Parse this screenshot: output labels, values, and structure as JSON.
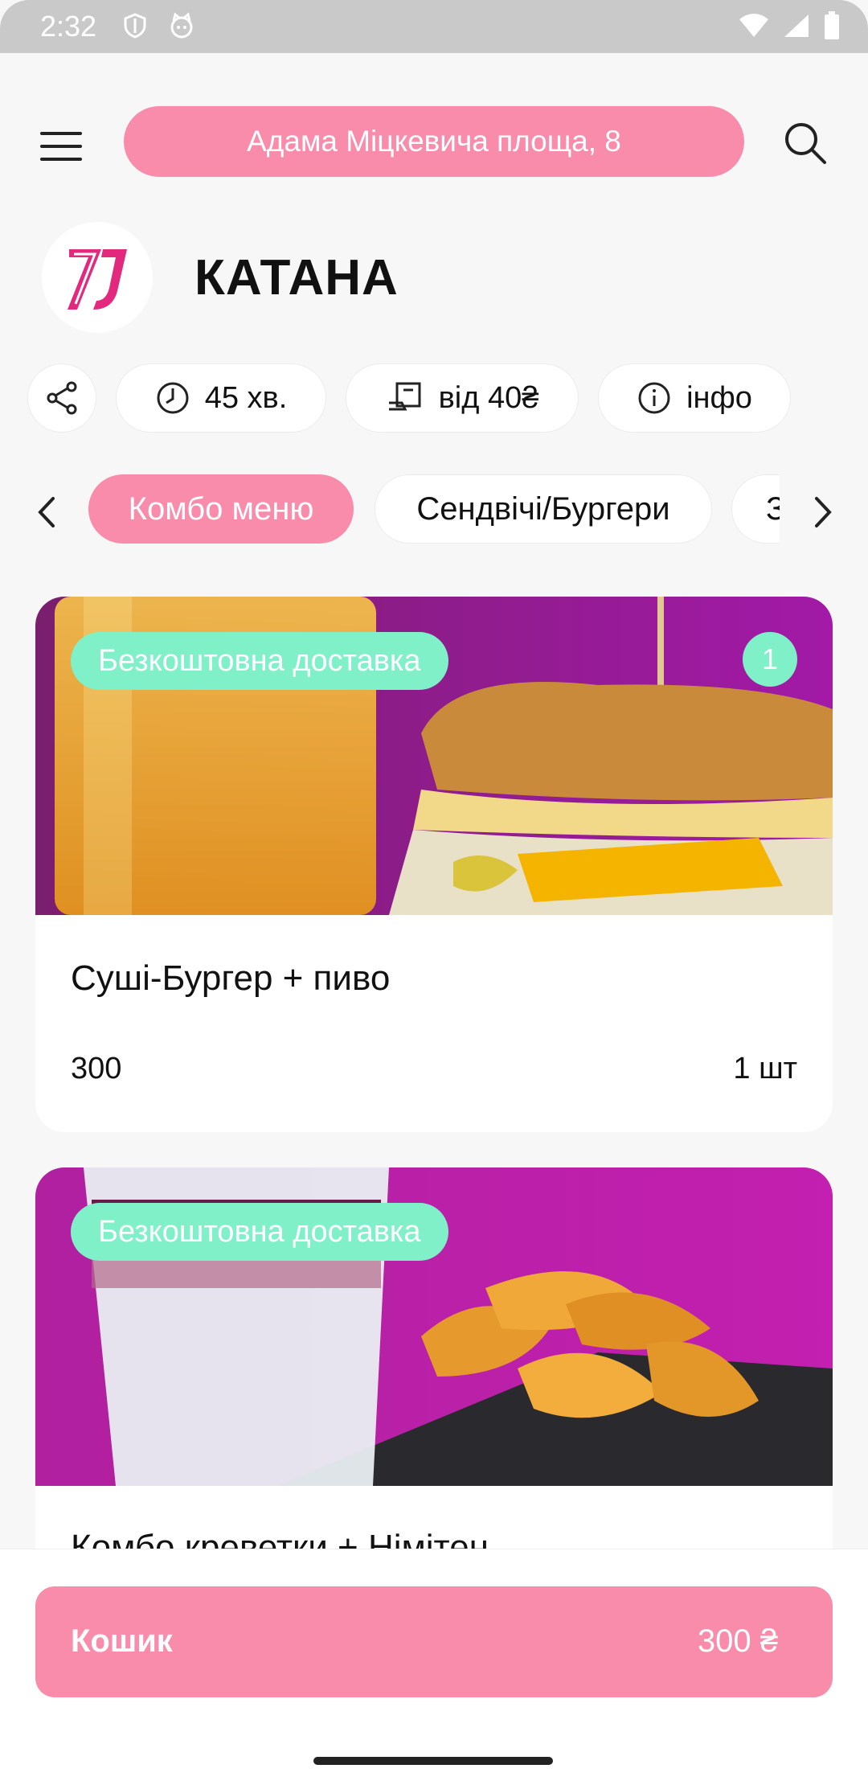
{
  "status_bar": {
    "time": "2:32"
  },
  "header": {
    "address": "Адама Міцкевича площа, 8"
  },
  "store": {
    "name": "КАТАНА"
  },
  "info_chips": {
    "delivery_time": "45 хв.",
    "min_order": "від 40₴",
    "info": "інфо"
  },
  "categories": {
    "items": [
      "Комбо меню",
      "Сендвічі/Бургери",
      "З"
    ]
  },
  "products": [
    {
      "badge": "Безкоштовна доставка",
      "qty_in_cart": "1",
      "title": "Суші-Бургер + пиво",
      "price": "300",
      "unit": "1 шт"
    },
    {
      "badge": "Безкоштовна доставка",
      "title": "Комбо креветки + Німітен"
    }
  ],
  "cart": {
    "label": "Кошик",
    "total": "300 ₴"
  },
  "colors": {
    "accent": "#f98cab",
    "badge": "#7ff0c8"
  }
}
